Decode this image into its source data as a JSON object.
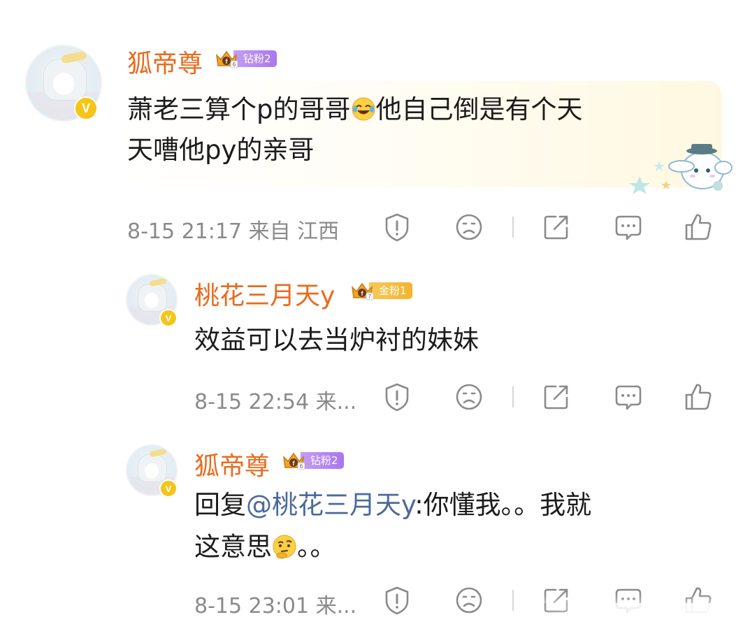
{
  "comments": [
    {
      "username": "狐帝尊",
      "badge": {
        "type": "diamond",
        "label": "钻粉2"
      },
      "content_line1_text": "萧老三算个p的哥哥",
      "content_line1_after_emoji": "他自己倒是有个天",
      "content_line2": "天嘈他py的亲哥",
      "meta": "8-15 21:17  来自 江西",
      "emoji": "laugh-cry-emoji"
    },
    {
      "username": "桃花三月天y",
      "badge": {
        "type": "gold",
        "label": "金粉1"
      },
      "content_line1": "效益可以去当炉衬的妹妹",
      "meta": "8-15 22:54  来..."
    },
    {
      "username": "狐帝尊",
      "badge": {
        "type": "diamond",
        "label": "钻粉2"
      },
      "content_prefix": "回复",
      "content_mention": "@桃花三月天y",
      "content_line1_rest": ":你懂我。。我就",
      "content_line2_text": "这意思",
      "content_line2_after_emoji": "。。",
      "meta": "8-15 23:01  来...",
      "emoji": "thinking-emoji"
    }
  ],
  "colors": {
    "username": "#e86b1d",
    "mention": "#4b6a9b",
    "meta": "#8a8a8a",
    "icon": "#8a8a8a",
    "vbadge": "#f5c518"
  },
  "actions": [
    "report-icon",
    "dislike-icon",
    "share-icon",
    "comment-icon",
    "like-icon"
  ]
}
